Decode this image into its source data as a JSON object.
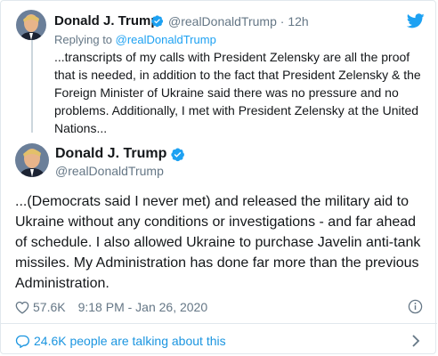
{
  "quoted_tweet": {
    "name": "Donald J. Trump",
    "handle": "@realDonaldTrump",
    "separator": "·",
    "time": "12h",
    "replying_prefix": "Replying to ",
    "replying_to": "@realDonaldTrump",
    "text": "...transcripts of my calls with President Zelensky are all the proof that is needed, in addition to the fact that President Zelensky & the Foreign Minister of Ukraine said there was no pressure and no problems. Additionally, I met with President Zelensky at the United Nations..."
  },
  "main_tweet": {
    "name": "Donald J. Trump",
    "handle": "@realDonaldTrump",
    "text": "...(Democrats said I never met) and released the military aid to Ukraine without any conditions or investigations - and far ahead of schedule. I also allowed Ukraine to purchase Javelin anti-tank missiles. My Administration has done far more than the previous Administration.",
    "likes": "57.6K",
    "timestamp": "9:18 PM - Jan 26, 2020"
  },
  "footer": {
    "talking": "24.6K people are talking about this"
  },
  "icons": {
    "verified": "verified-badge-icon",
    "twitter": "twitter-bird-icon",
    "heart": "heart-icon",
    "info": "info-icon",
    "comment": "comment-bubble-icon",
    "chevron": "chevron-right-icon"
  },
  "colors": {
    "accent": "#1da1f2",
    "secondary_text": "#657786",
    "primary_text": "#14171a"
  }
}
